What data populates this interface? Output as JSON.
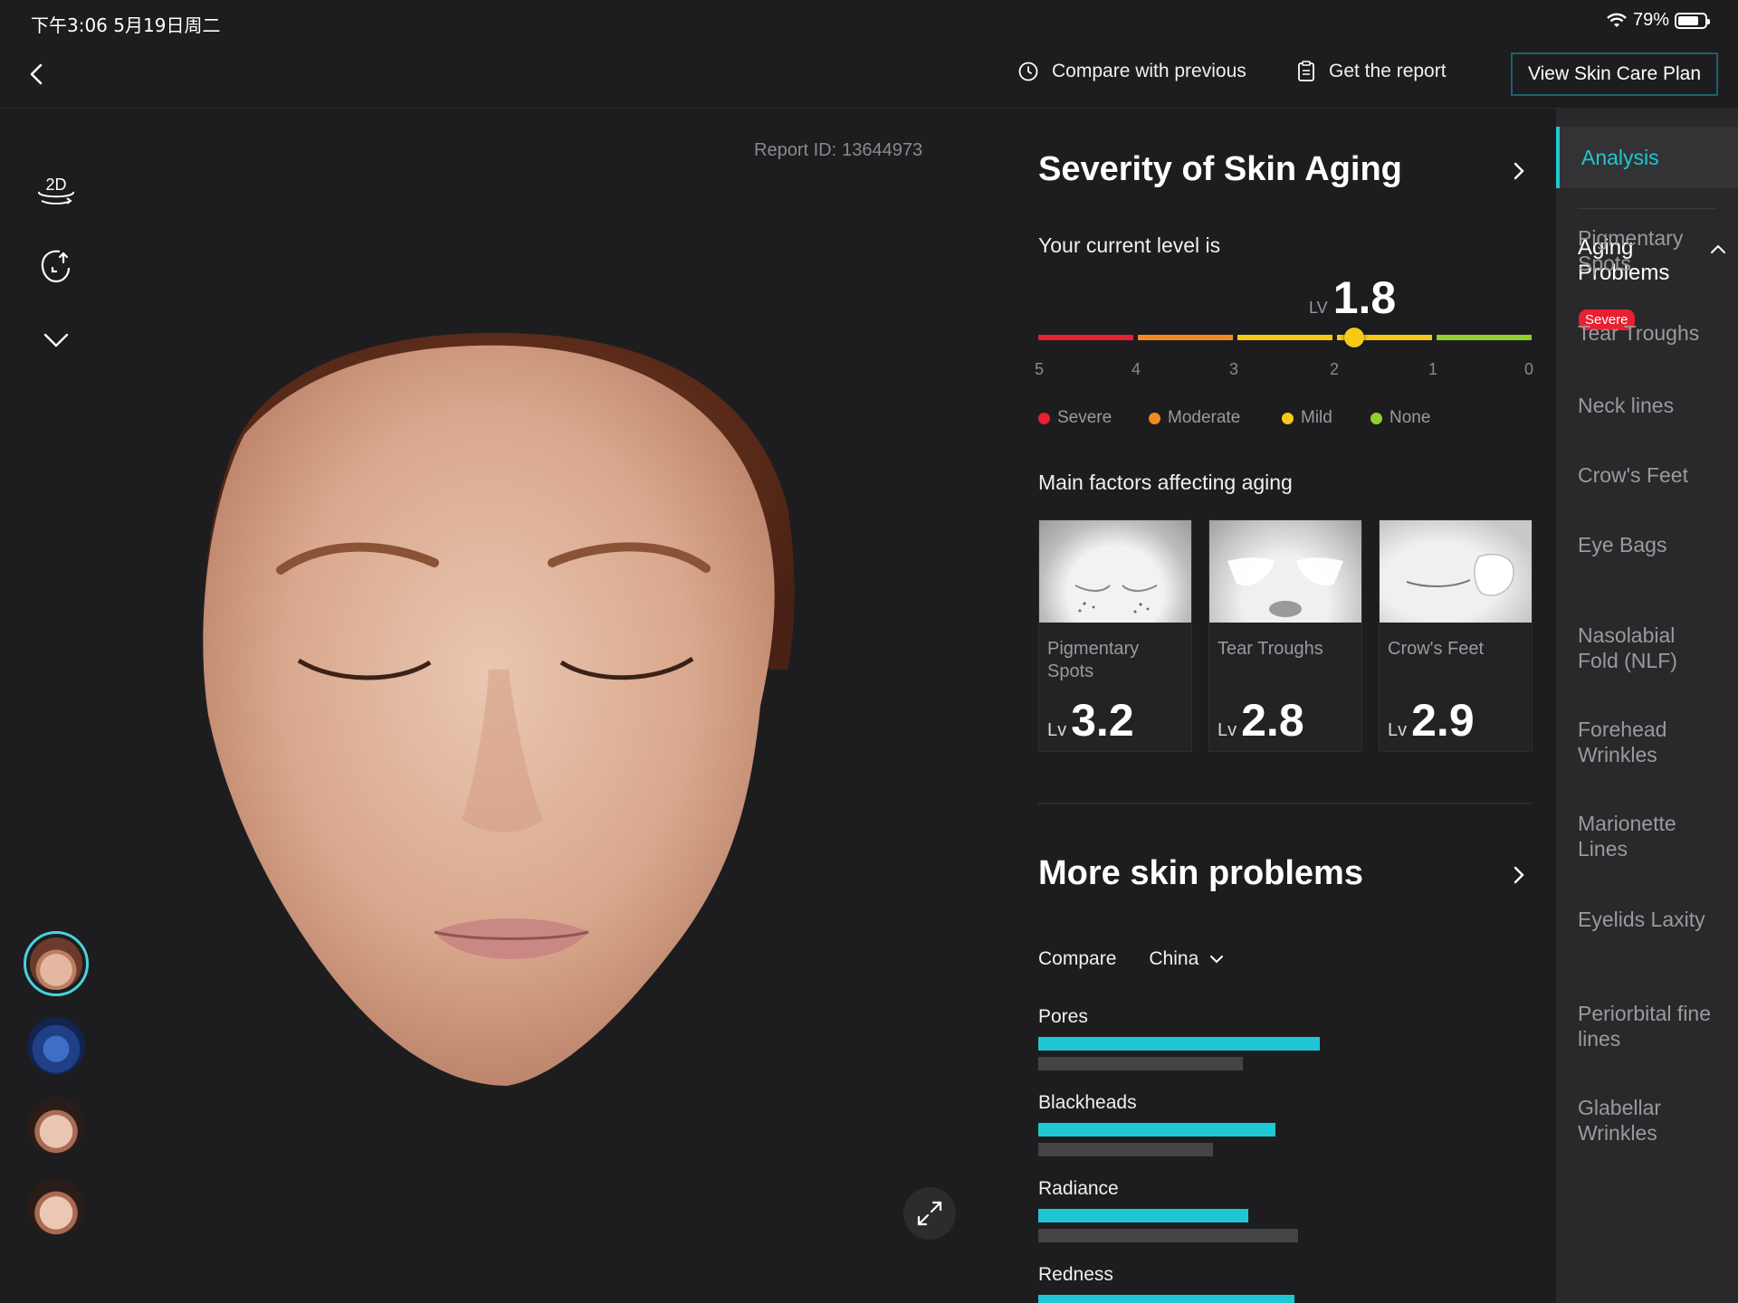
{
  "status": {
    "time": "下午3:06  5月19日周二",
    "battery": "79%",
    "battery_level": 0.79
  },
  "toolbar": {
    "compare_label": "Compare with previous",
    "report_label": "Get the report",
    "plan_label": "View Skin Care Plan"
  },
  "left_tools": {
    "view_mode_label": "2D"
  },
  "report": {
    "label": "Report ID:",
    "id": "13644973"
  },
  "aging": {
    "title": "Severity of Skin Aging",
    "intro": "Your current level is",
    "lv_label": "LV",
    "level": "1.8",
    "level_value": 1.8,
    "scale_ticks": [
      "5",
      "4",
      "3",
      "2",
      "1",
      "0"
    ],
    "legend": [
      {
        "label": "Severe",
        "color": "#e8202f"
      },
      {
        "label": "Moderate",
        "color": "#f28a1f"
      },
      {
        "label": "Mild",
        "color": "#f6c915"
      },
      {
        "label": "None",
        "color": "#8fd12a"
      }
    ],
    "factors_title": "Main factors affecting aging",
    "factors": [
      {
        "name": "Pigmentary Spots",
        "lv_label": "Lv",
        "level": "3.2"
      },
      {
        "name": "Tear Troughs",
        "lv_label": "Lv",
        "level": "2.8"
      },
      {
        "name": "Crow's Feet",
        "lv_label": "Lv",
        "level": "2.9"
      }
    ]
  },
  "more": {
    "title": "More skin problems",
    "compare_label": "Compare",
    "region": "China",
    "bars": [
      {
        "label": "Pores",
        "value": 0.57,
        "baseline": 0.415
      },
      {
        "label": "Blackheads",
        "value": 0.48,
        "baseline": 0.355
      },
      {
        "label": "Radiance",
        "value": 0.425,
        "baseline": 0.527
      },
      {
        "label": "Redness",
        "value": 0.52,
        "baseline": 0.4
      }
    ]
  },
  "sidebar": {
    "analysis_label": "Analysis",
    "group_label": "Aging Problems",
    "badge": "Severe",
    "items": [
      "Pigmentary Spots",
      "Tear Troughs",
      "Neck lines",
      "Crow's Feet",
      "Eye Bags",
      "Nasolabial Fold (NLF)",
      "Forehead Wrinkles",
      "Marionette Lines",
      "Eyelids Laxity",
      "Periorbital fine lines",
      "Glabellar Wrinkles"
    ]
  },
  "colors": {
    "accent": "#1fc7d4",
    "background": "#1d1d1f",
    "sidebar": "#29292b"
  }
}
